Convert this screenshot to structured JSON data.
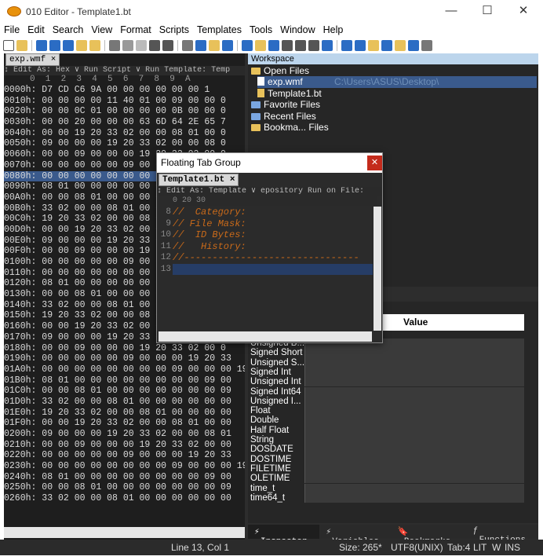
{
  "window": {
    "title": "010 Editor - Template1.bt"
  },
  "menu": [
    "File",
    "Edit",
    "Search",
    "View",
    "Format",
    "Scripts",
    "Templates",
    "Tools",
    "Window",
    "Help"
  ],
  "hex": {
    "tab": "exp.wmf ×",
    "bar": "↕ Edit As: Hex ∨ Run Script ∨ Run Template: Temp",
    "cols": "     0  1  2  3  4  5  6  7  8  9  A",
    "rows": [
      "0000h: D7 CD C6 9A 00 00 00 00 00 00 1",
      "0010h: 00 00 00 00 11 40 01 00 09 00 00 0",
      "0020h: 00 00 0C 01 00 00 00 00 0B 00 00 0",
      "0030h: 00 00 20 00 00 00 63 6D 64 2E 65 7",
      "0040h: 00 00 19 20 33 02 00 00 08 01 00 0",
      "0050h: 09 00 00 00 19 20 33 02 00 00 08 0",
      "0060h: 00 00 09 00 00 00 19 20 33 02 00 0",
      "0070h: 00 00 00 00 00 09 00 00 00 19 20 3",
      "0080h: 00 00 00 00 00 00 00 00 09 00 00 0",
      "0090h: 08 01 00 00 00 00 00 00 00 00 09 0",
      "00A0h: 00 00 08 01 00 00 00 00 00 00 00 0",
      "00B0h: 33 02 00 00 08 01 00 00 00 00 00 0",
      "00C0h: 19 20 33 02 00 00 08 01 00 00 00 0",
      "00D0h: 00 00 19 20 33 02 00 00 08 01 00 0",
      "00E0h: 09 00 00 00 19 20 33 02 00 00 08 0",
      "00F0h: 00 00 09 00 00 00 19 20 33 02 00 0",
      "0100h: 00 00 00 00 00 09 00 00 00 19 20 3",
      "0110h: 00 00 00 00 00 00 00 00 09 00 00 0",
      "0120h: 08 01 00 00 00 00 00 00 00 00 09 0",
      "0130h: 00 00 08 01 00 00 00 00 00 00 00 0",
      "0140h: 33 02 00 00 08 01 00 00 00 00 00 0",
      "0150h: 19 20 33 02 00 00 08 01 00 00 00 0",
      "0160h: 00 00 19 20 33 02 00 00 08 01 00 0",
      "0170h: 09 00 00 00 19 20 33 02 00 00 08 0",
      "0180h: 00 00 09 00 00 00 19 20 33 02 00 0",
      "0190h: 00 00 00 00 00 09 00 00 00 19 20 33",
      "01A0h: 00 00 00 00 00 00 00 00 09 00 00 00 19 2",
      "01B0h: 08 01 00 00 00 00 00 00 00 00 09 00",
      "01C0h: 00 00 08 01 00 00 00 00 00 00 00 09",
      "01D0h: 33 02 00 00 08 01 00 00 00 00 00 00",
      "01E0h: 19 20 33 02 00 00 08 01 00 00 00 00",
      "01F0h: 00 00 19 20 33 02 00 00 08 01 00 00",
      "0200h: 09 00 00 00 19 20 33 02 00 00 08 01",
      "0210h: 00 00 09 00 00 00 19 20 33 02 00 00",
      "0220h: 00 00 00 00 00 09 00 00 00 19 20 33",
      "0230h: 00 00 00 00 00 00 00 00 09 00 00 00 19 2",
      "0240h: 08 01 00 00 00 00 00 00 00 00 09 00",
      "0250h: 00 00 08 01 00 00 00 00 00 00 00 09",
      "0260h: 33 02 00 00 08 01 00 00 00 00 00 00"
    ]
  },
  "workspace": {
    "title": "Workspace",
    "open_files": "Open Files",
    "exp": "exp.wmf",
    "exp_path": "C:\\Users\\ASUS\\Desktop\\",
    "template": "Template1.bt",
    "favorites": "Favorite Files",
    "recent": "Recent Files",
    "bookmarks": "Bookma... Files"
  },
  "inspector": {
    "value_header": "Value",
    "rows": [
      "Unsigned B...",
      "Signed Short",
      "Unsigned S...",
      "Signed Int",
      "Unsigned Int",
      "Signed Int64",
      "Unsigned I...",
      "Float",
      "Double",
      "Half Float",
      "String",
      "DOSDATE",
      "DOSTIME",
      "FILETIME",
      "OLETIME",
      "time_t",
      "time64_t"
    ],
    "tabs": [
      "Inspector",
      "Variables",
      "Bookmarks",
      "Functions"
    ]
  },
  "status": {
    "pos": "Line 13, Col 1",
    "size": "Size: 265*",
    "enc": "UTF8(UNIX)",
    "tab": "Tab:4",
    "lit": "LIT",
    "w": "W",
    "ins": "INS"
  },
  "floating": {
    "title": "Floating Tab Group",
    "tab": "Template1.bt ×",
    "bar": "↕ Edit As: Template ∨  epository  Run on File: ",
    "ruler": "0          20         30",
    "lines": [
      {
        "n": "8",
        "t": "//  Category:"
      },
      {
        "n": "9",
        "t": "// File Mask:"
      },
      {
        "n": "10",
        "t": "//  ID Bytes:"
      },
      {
        "n": "11",
        "t": "//   History:"
      },
      {
        "n": "12",
        "t": "//-------------------------------"
      },
      {
        "n": "13",
        "t": ""
      }
    ]
  }
}
